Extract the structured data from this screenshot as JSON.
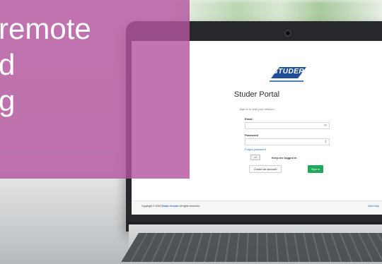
{
  "overlay": {
    "line1": "remote",
    "line2": "d",
    "line3": "g"
  },
  "portal": {
    "logo_text": "STUDER",
    "title": "Studer Portal",
    "subtitle": "Sign in to start your session",
    "email_label": "Email",
    "password_label": "Password",
    "forgot_link": "Forgot password",
    "toggle_label": "off",
    "keep_logged_label": "Keep me logged in",
    "create_account_label": "Create an account",
    "sign_in_label": "Sign in",
    "footer_copyright_prefix": "Copyright © 2019",
    "footer_brand": "Studer Innotec",
    "footer_copyright_suffix": "All rights reserved.",
    "footer_link": "Need help"
  },
  "colors": {
    "overlay": "#b3569e",
    "sign_in": "#1fa85a",
    "link": "#2d6bb5",
    "logo": "#1f4f9a"
  },
  "icons": {
    "email_field": "envelope-icon",
    "password_field": "key-icon"
  }
}
